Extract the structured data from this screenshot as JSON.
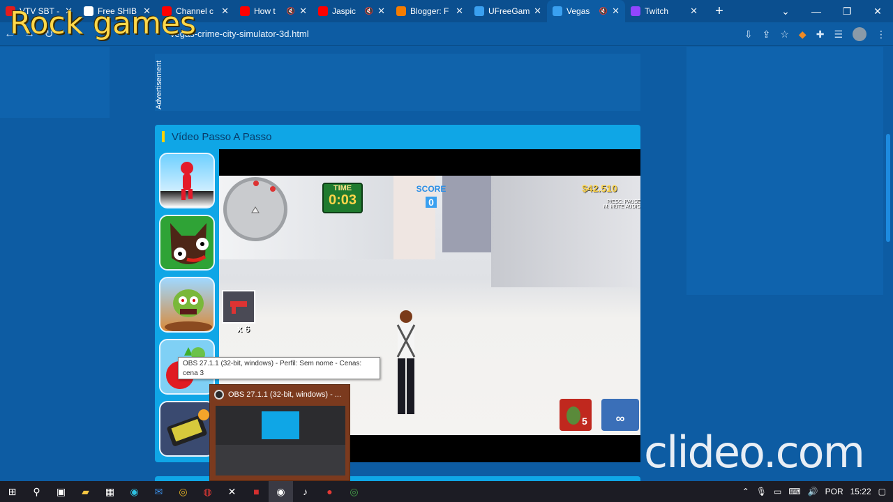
{
  "browser": {
    "tabs": [
      {
        "label": "VTV SBT -",
        "favicon_color": "#e21c1c",
        "muted": false
      },
      {
        "label": "Free SHIB",
        "favicon_color": "#ffffff",
        "muted": false
      },
      {
        "label": "Channel c",
        "favicon_color": "#ff0000",
        "muted": false
      },
      {
        "label": "How t",
        "favicon_color": "#ff0000",
        "muted": true
      },
      {
        "label": "Jaspic",
        "favicon_color": "#ff0000",
        "muted": true
      },
      {
        "label": "Blogger: F",
        "favicon_color": "#f57c00",
        "muted": false
      },
      {
        "label": "UFreeGam",
        "favicon_color": "#3aa0f0",
        "muted": false
      },
      {
        "label": "Vegas",
        "favicon_color": "#3aa0f0",
        "muted": true
      },
      {
        "label": "Twitch",
        "favicon_color": "#9146ff",
        "muted": false
      }
    ],
    "active_tab_index": 7,
    "new_tab": "+",
    "url": "ufreegames.com/play/vegas-crime-city-simulator-3d.html",
    "url_shown": "vegas-crime-city-simulator-3d.html"
  },
  "overlay": {
    "rock_games": "Rock games",
    "clideo": "clideo.com"
  },
  "page": {
    "advertisement": "Advertisement",
    "section_title": "Vídeo Passo A Passo"
  },
  "game": {
    "time_label": "TIME",
    "time_value": "0:03",
    "score_label": "SCORE",
    "score_value": "0",
    "money": "$42.510",
    "keys_line1": "P/ESC: PAUSE",
    "keys_line2": "M: MUTE AUDIO",
    "ammo": "x 6",
    "grenades": "5",
    "gun_ammo": "∞"
  },
  "taskbar_popup": {
    "tooltip": "OBS 27.1.1 (32-bit, windows) - Perfil: Sem nome - Cenas: cena 3",
    "preview_title": "OBS 27.1.1 (32-bit, windows) - ..."
  },
  "system_tray": {
    "language": "POR",
    "time": "15:22"
  }
}
